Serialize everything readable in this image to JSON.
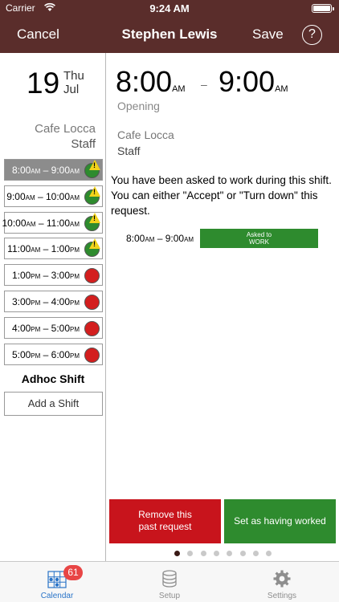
{
  "status_bar": {
    "carrier": "Carrier",
    "time": "9:24 AM"
  },
  "nav": {
    "cancel_label": "Cancel",
    "title": "Stephen Lewis",
    "save_label": "Save",
    "help_label": "?"
  },
  "date": {
    "day": "19",
    "weekday": "Thu",
    "month": "Jul"
  },
  "location": {
    "name": "Cafe Locca",
    "role": "Staff"
  },
  "shifts": [
    {
      "start": "8:00",
      "start_ampm": "AM",
      "end": "9:00",
      "end_ampm": "AM",
      "status": "green-warning",
      "selected": true
    },
    {
      "start": "9:00",
      "start_ampm": "AM",
      "end": "10:00",
      "end_ampm": "AM",
      "status": "green-warning"
    },
    {
      "start": "10:00",
      "start_ampm": "AM",
      "end": "11:00",
      "end_ampm": "AM",
      "status": "green-warning"
    },
    {
      "start": "11:00",
      "start_ampm": "AM",
      "end": "1:00",
      "end_ampm": "PM",
      "status": "green-warning"
    },
    {
      "start": "1:00",
      "start_ampm": "PM",
      "end": "3:00",
      "end_ampm": "PM",
      "status": "red"
    },
    {
      "start": "3:00",
      "start_ampm": "PM",
      "end": "4:00",
      "end_ampm": "PM",
      "status": "red"
    },
    {
      "start": "4:00",
      "start_ampm": "PM",
      "end": "5:00",
      "end_ampm": "PM",
      "status": "red"
    },
    {
      "start": "5:00",
      "start_ampm": "PM",
      "end": "6:00",
      "end_ampm": "PM",
      "status": "red"
    }
  ],
  "adhoc": {
    "title": "Adhoc Shift",
    "add_label": "Add a Shift"
  },
  "detail": {
    "start": "8:00",
    "start_ampm": "AM",
    "dash": "–",
    "end": "9:00",
    "end_ampm": "AM",
    "type": "Opening",
    "location": "Cafe Locca",
    "role": "Staff",
    "message": "You have been asked to work during this shift. You can either \"Accept\" or \"Turn down\" this request.",
    "request": {
      "start": "8:00",
      "start_ampm": "AM",
      "end": "9:00",
      "end_ampm": "AM",
      "badge_line1": "Asked to",
      "badge_line2": "WORK"
    },
    "remove_line1": "Remove this",
    "remove_line2": "past request",
    "worked_label": "Set as having worked",
    "page_count": 8,
    "active_page": 1
  },
  "tabs": [
    {
      "label": "Calendar",
      "icon": "calendar-icon",
      "badge": "61",
      "active": true
    },
    {
      "label": "Setup",
      "icon": "database-icon"
    },
    {
      "label": "Settings",
      "icon": "gear-icon"
    }
  ],
  "colors": {
    "nav_bg": "#5a2d2b",
    "green": "#2e8b2e",
    "red": "#c8141c",
    "tab_active": "#2a74c8",
    "badge": "#e84545"
  }
}
